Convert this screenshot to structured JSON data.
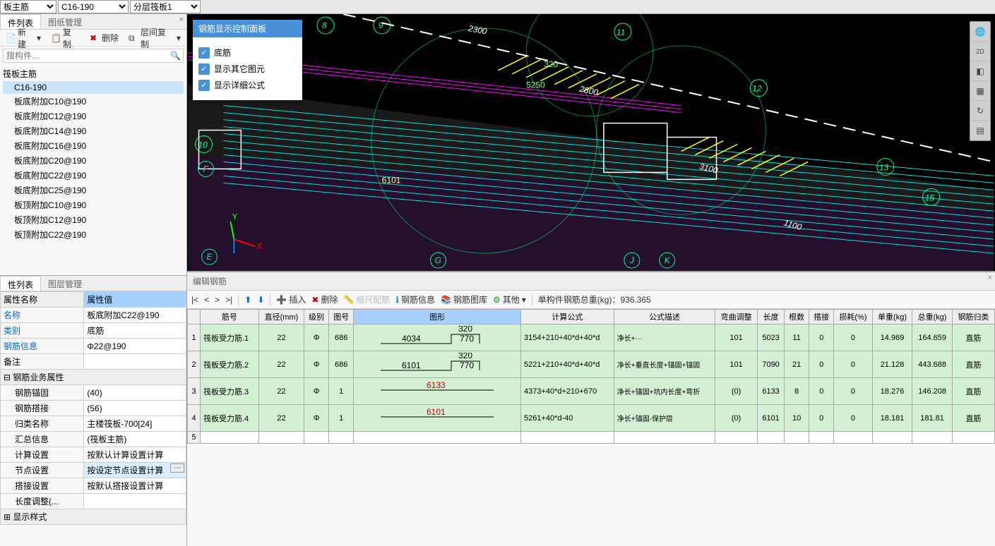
{
  "topbar": {
    "sel1": "板主筋",
    "sel2": "C16-190",
    "sel3": "分层筏板1"
  },
  "componentPanel": {
    "tabs": [
      "件列表",
      "图纸管理"
    ],
    "toolbar": {
      "new": "新建",
      "copy": "复制",
      "delete": "删除",
      "layerCopy": "层间复制"
    },
    "searchPlaceholder": "搜构件...",
    "treeRoot": "筏板主筋",
    "items": [
      "C16-190",
      "板底附加C10@190",
      "板底附加C12@190",
      "板底附加C14@190",
      "板底附加C16@190",
      "板底附加C20@190",
      "板底附加C22@190",
      "板底附加C25@190",
      "板顶附加C10@190",
      "板顶附加C12@190",
      "板顶附加C22@190"
    ],
    "selectedIndex": 0
  },
  "propertyPanel": {
    "tabs": [
      "性列表",
      "图层管理"
    ],
    "headers": [
      "属性名称",
      "属性值"
    ],
    "rows": [
      {
        "t": "name",
        "label": "名称",
        "value": "板底附加C22@190"
      },
      {
        "t": "name",
        "label": "类别",
        "value": "底筋"
      },
      {
        "t": "name",
        "label": "钢筋信息",
        "value": "Φ22@190"
      },
      {
        "t": "plain",
        "label": "备注",
        "value": ""
      },
      {
        "t": "group",
        "label": "钢筋业务属性",
        "value": ""
      },
      {
        "t": "sub",
        "label": "钢筋锚固",
        "value": "(40)"
      },
      {
        "t": "sub",
        "label": "钢筋搭接",
        "value": "(56)"
      },
      {
        "t": "sub",
        "label": "归类名称",
        "value": "主楼筏板-700[24]"
      },
      {
        "t": "sub",
        "label": "汇总信息",
        "value": "(筏板主筋)"
      },
      {
        "t": "sub",
        "label": "计算设置",
        "value": "按默认计算设置计算"
      },
      {
        "t": "subsel",
        "label": "节点设置",
        "value": "按设定节点设置计算"
      },
      {
        "t": "sub",
        "label": "搭接设置",
        "value": "按默认搭接设置计算"
      },
      {
        "t": "sub",
        "label": "长度调整(...",
        "value": ""
      },
      {
        "t": "group2",
        "label": "显示样式",
        "value": ""
      }
    ]
  },
  "floatPanel": {
    "title": "钢筋显示控制面板",
    "checks": [
      "底筋",
      "显示其它图元",
      "显示详细公式"
    ]
  },
  "viewport": {
    "gridNumbers": [
      "8",
      "9",
      "11",
      "12",
      "13",
      "15",
      "10"
    ],
    "gridLetters": [
      "E",
      "F",
      "G",
      "J",
      "K"
    ],
    "dims": [
      "2300",
      "2800",
      "3100",
      "1100",
      "320",
      "5250",
      "6101"
    ]
  },
  "bottomPanel": {
    "title": "编辑钢筋",
    "toolbar": {
      "nav": [
        "|<",
        "<",
        ">",
        ">|"
      ],
      "insert": "插入",
      "delete": "删除",
      "scale": "缩尺配筋",
      "info": "钢筋信息",
      "lib": "钢筋图库",
      "other": "其他",
      "totalLabel": "单构件钢筋总重(kg)：",
      "totalValue": "936.365"
    },
    "headers": [
      "筋号",
      "直径(mm)",
      "级别",
      "图号",
      "图形",
      "计算公式",
      "公式描述",
      "弯曲调整",
      "长度",
      "根数",
      "搭接",
      "损耗(%)",
      "单重(kg)",
      "总重(kg)",
      "钢筋归类"
    ],
    "rows": [
      {
        "n": "1",
        "name": "筏板受力筋.1",
        "dia": "22",
        "grade": "Φ",
        "code": "686",
        "diagram": {
          "top": "320",
          "mid": "4034",
          "right": "770",
          "type": "r1"
        },
        "formula": "3154+210+40*d+40*d",
        "desc": "净长+···",
        "bend": "101",
        "len": "5023",
        "cnt": "11",
        "lap": "0",
        "loss": "0",
        "uw": "14.969",
        "tw": "164.659",
        "cat": "直筋"
      },
      {
        "n": "2",
        "name": "筏板受力筋.2",
        "dia": "22",
        "grade": "Φ",
        "code": "686",
        "diagram": {
          "top": "320",
          "mid": "6101",
          "right": "770",
          "type": "r1"
        },
        "formula": "5221+210+40*d+40*d",
        "desc": "净长+垂直长度+锚固+锚固",
        "bend": "101",
        "len": "7090",
        "cnt": "21",
        "lap": "0",
        "loss": "0",
        "uw": "21.128",
        "tw": "443.688",
        "cat": "直筋"
      },
      {
        "n": "3",
        "name": "筏板受力筋.3",
        "dia": "22",
        "grade": "Φ",
        "code": "1",
        "diagram": {
          "mid": "6133",
          "type": "r2"
        },
        "formula": "4373+40*d+210+670",
        "desc": "净长+锚固+坑内长度+弯折",
        "bend": "(0)",
        "len": "6133",
        "cnt": "8",
        "lap": "0",
        "loss": "0",
        "uw": "18.276",
        "tw": "146.208",
        "cat": "直筋"
      },
      {
        "n": "4",
        "name": "筏板受力筋.4",
        "dia": "22",
        "grade": "Φ",
        "code": "1",
        "diagram": {
          "mid": "6101",
          "type": "r2"
        },
        "formula": "5261+40*d-40",
        "desc": "净长+锚固-保护层",
        "bend": "(0)",
        "len": "6101",
        "cnt": "10",
        "lap": "0",
        "loss": "0",
        "uw": "18.181",
        "tw": "181.81",
        "cat": "直筋"
      },
      {
        "n": "5",
        "name": "",
        "dia": "",
        "grade": "",
        "code": "",
        "diagram": null,
        "formula": "",
        "desc": "",
        "bend": "",
        "len": "",
        "cnt": "",
        "lap": "",
        "loss": "",
        "uw": "",
        "tw": "",
        "cat": ""
      }
    ]
  }
}
